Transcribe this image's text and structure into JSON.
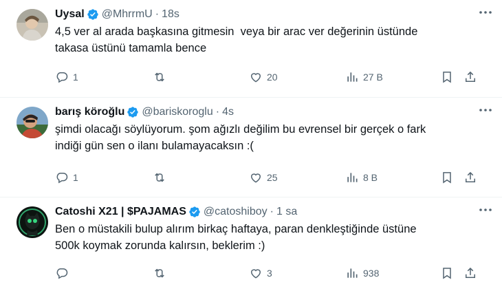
{
  "tweets": [
    {
      "name": "Uysal",
      "handle": "@MhrrmU",
      "dot": "·",
      "time": "18s",
      "text": "4,5 ver al arada başkasına gitmesin  veya bir arac ver değerinin üstünde\ntakasa üstünü tamamla bence",
      "replies": "1",
      "retweets": "",
      "likes": "20",
      "views": "27 B"
    },
    {
      "name": "barış köroğlu",
      "handle": "@bariskoroglu",
      "dot": "·",
      "time": "4s",
      "text": "şimdi olacağı söylüyorum. şom ağızlı değilim bu evrensel bir gerçek o fark\nindiği gün sen o ilanı bulamayacaksın :(",
      "replies": "1",
      "retweets": "",
      "likes": "25",
      "views": "8 B"
    },
    {
      "name": "Catoshi X21 | $PAJAMAS",
      "handle": "@catoshiboy",
      "dot": "·",
      "time": "1 sa",
      "text": "Ben o müstakili bulup alırım birkaç haftaya, paran denkleştiğinde üstüne\n500k koymak zorunda kalırsın, beklerim :)",
      "replies": "",
      "retweets": "",
      "likes": "3",
      "views": "938"
    }
  ],
  "colors": {
    "verified": "#1d9bf0",
    "secondary": "#536471",
    "divider": "#eff3f4"
  }
}
